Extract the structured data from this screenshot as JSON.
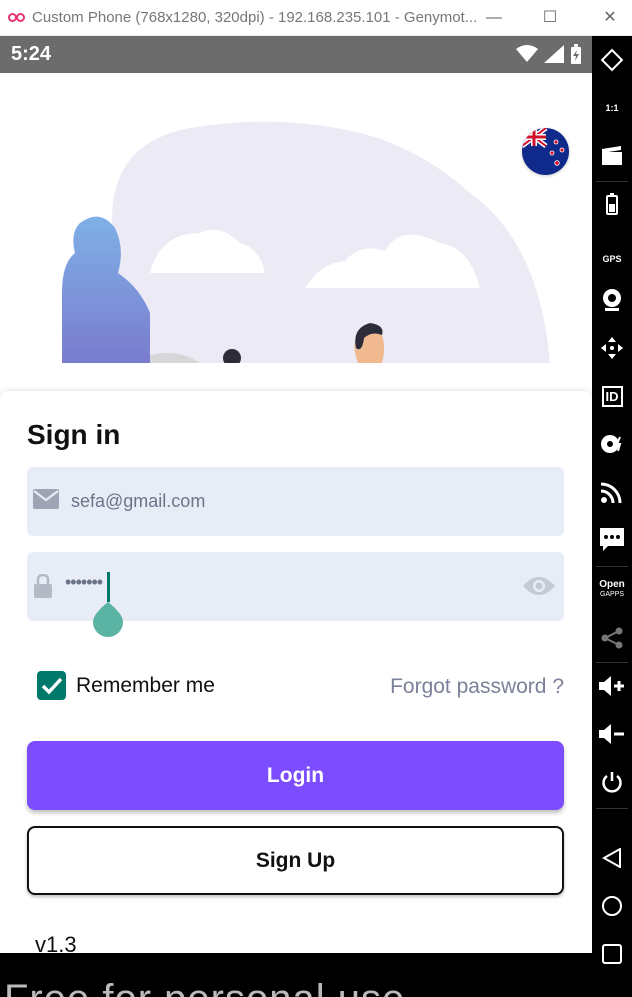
{
  "window": {
    "title": "Custom Phone (768x1280, 320dpi) - 192.168.235.101 - Genymot...",
    "minimize": "—",
    "maximize": "☐",
    "close": "✕"
  },
  "status_bar": {
    "time": "5:24"
  },
  "language_flag": "new-zealand-flag-icon",
  "signin": {
    "title": "Sign in",
    "email_value": "sefa@gmail.com",
    "password_value": "•••••••",
    "remember_label": "Remember me",
    "remember_checked": true,
    "forgot_label": "Forgot password ?",
    "login_label": "Login",
    "signup_label": "Sign Up",
    "version": "v1.3"
  },
  "watermark": "Free for personal use",
  "colors": {
    "accent": "#7c4dff",
    "checkbox": "#00796b",
    "field_bg": "#e7ecf6",
    "status_bar": "#6c6c6c"
  },
  "toolbar_icons": [
    "rotate-icon",
    "pixel-perfect-icon",
    "screencast-icon",
    "battery-icon",
    "gps-icon",
    "camera-icon",
    "dpad-icon",
    "identifiers-icon",
    "disk-io-icon",
    "network-icon",
    "sms-icon",
    "open-gapps-icon",
    "share-icon",
    "volume-up-icon",
    "volume-down-icon",
    "power-icon",
    "back-icon",
    "home-icon",
    "recent-apps-icon"
  ],
  "toolbar": {
    "pixel_perfect": "1:1",
    "gps": "GPS",
    "id": "ID",
    "open": "Open",
    "gapps": "GAPPS"
  }
}
